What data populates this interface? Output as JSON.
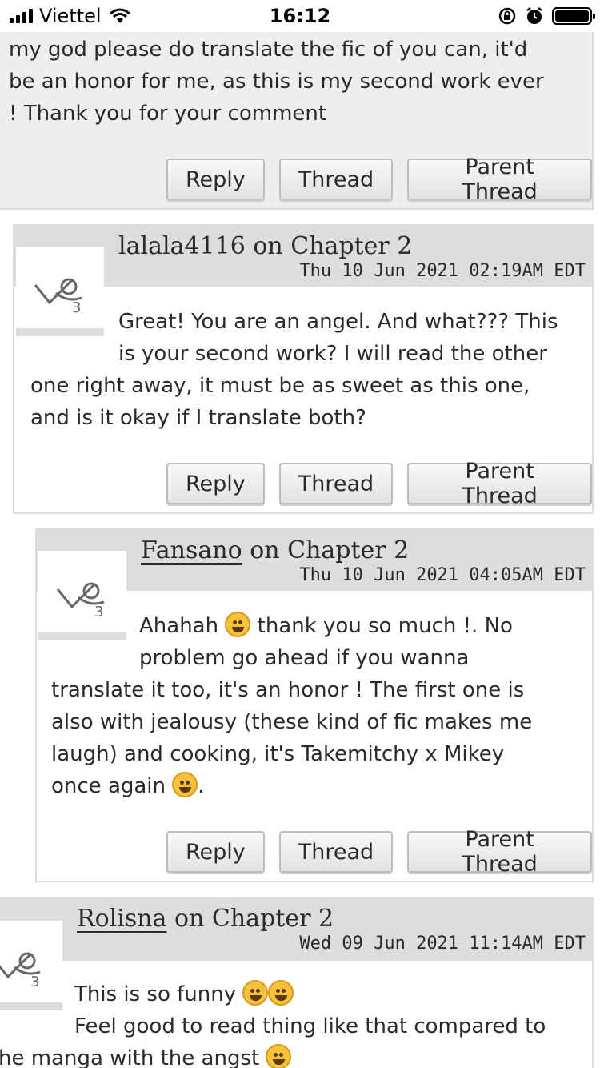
{
  "status_bar": {
    "carrier": "Viettel",
    "time": "16:12"
  },
  "buttons": {
    "reply": "Reply",
    "thread": "Thread",
    "parent_thread": "Parent Thread"
  },
  "comments": [
    {
      "text_lines": [
        "my god please do translate the fic of you can, it'd",
        "be an honor for me, as this is my second work ever",
        "! Thank you for your comment"
      ]
    },
    {
      "author": "lalala4116",
      "chapter_suffix": " on Chapter 2",
      "date": "Thu 10 Jun 2021 02:19AM EDT",
      "text_lines": [
        "Great! You are an angel. And what??? This",
        "is your second work? I will read the other",
        "one right away, it must be as sweet as this one,",
        "and is it okay if I translate both?"
      ]
    },
    {
      "author": "Fansano",
      "chapter_suffix": " on Chapter 2",
      "date": "Thu 10 Jun 2021 04:05AM EDT",
      "text_lines": [
        "Ahahah",
        "thank you so much !. No",
        "problem go ahead if you wanna",
        "translate it too, it's an honor ! The first one is",
        "also with jealousy (these kind of fic makes me",
        "laugh) and cooking, it's Takemitchy x Mikey",
        "once again",
        "."
      ]
    },
    {
      "author": "Rolisna",
      "chapter_suffix": " on Chapter 2",
      "date": "Wed 09 Jun 2021 11:14AM EDT",
      "text_lines": [
        "This is so funny",
        "Feel good to read thing like that compared to",
        "he manga with the angst"
      ]
    }
  ]
}
